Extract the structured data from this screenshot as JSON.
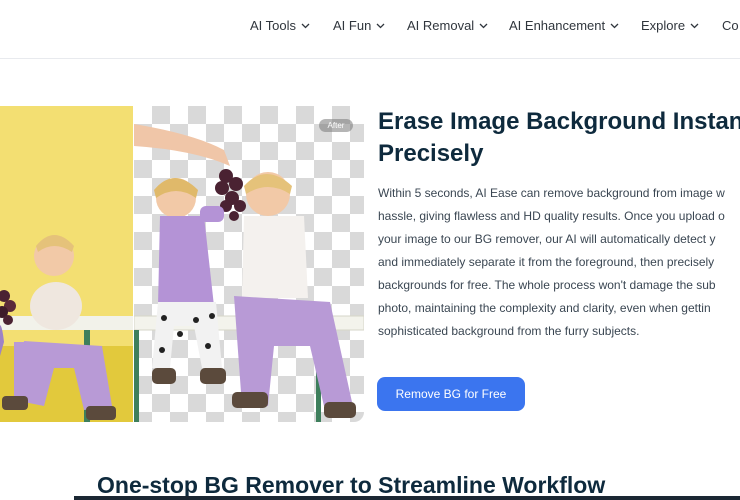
{
  "nav": {
    "items": [
      {
        "label": "AI Tools"
      },
      {
        "label": "AI Fun"
      },
      {
        "label": "AI Removal"
      },
      {
        "label": "AI Enhancement"
      },
      {
        "label": "Explore"
      },
      {
        "label": "Co"
      }
    ]
  },
  "hero": {
    "badge": "After",
    "title_line1": "Erase Image Background Instan",
    "title_line2": "Precisely",
    "body_lines": [
      "Within 5 seconds, AI Ease can remove background from image w",
      "hassle, giving flawless and HD quality results. Once you upload o",
      "your image to our BG remover, our AI will automatically detect y",
      "and immediately separate it from the foreground, then precisely",
      "backgrounds for free. The whole process won't damage the sub",
      "photo, maintaining the complexity and clarity, even when gettin",
      "sophisticated background from the furry subjects."
    ],
    "cta_label": "Remove BG for Free"
  },
  "section": {
    "title": "One-stop BG Remover to Streamline Workflow"
  },
  "colors": {
    "accent": "#3b75ef",
    "heading": "#0e2a3d",
    "before_bg": "#f3df72"
  }
}
